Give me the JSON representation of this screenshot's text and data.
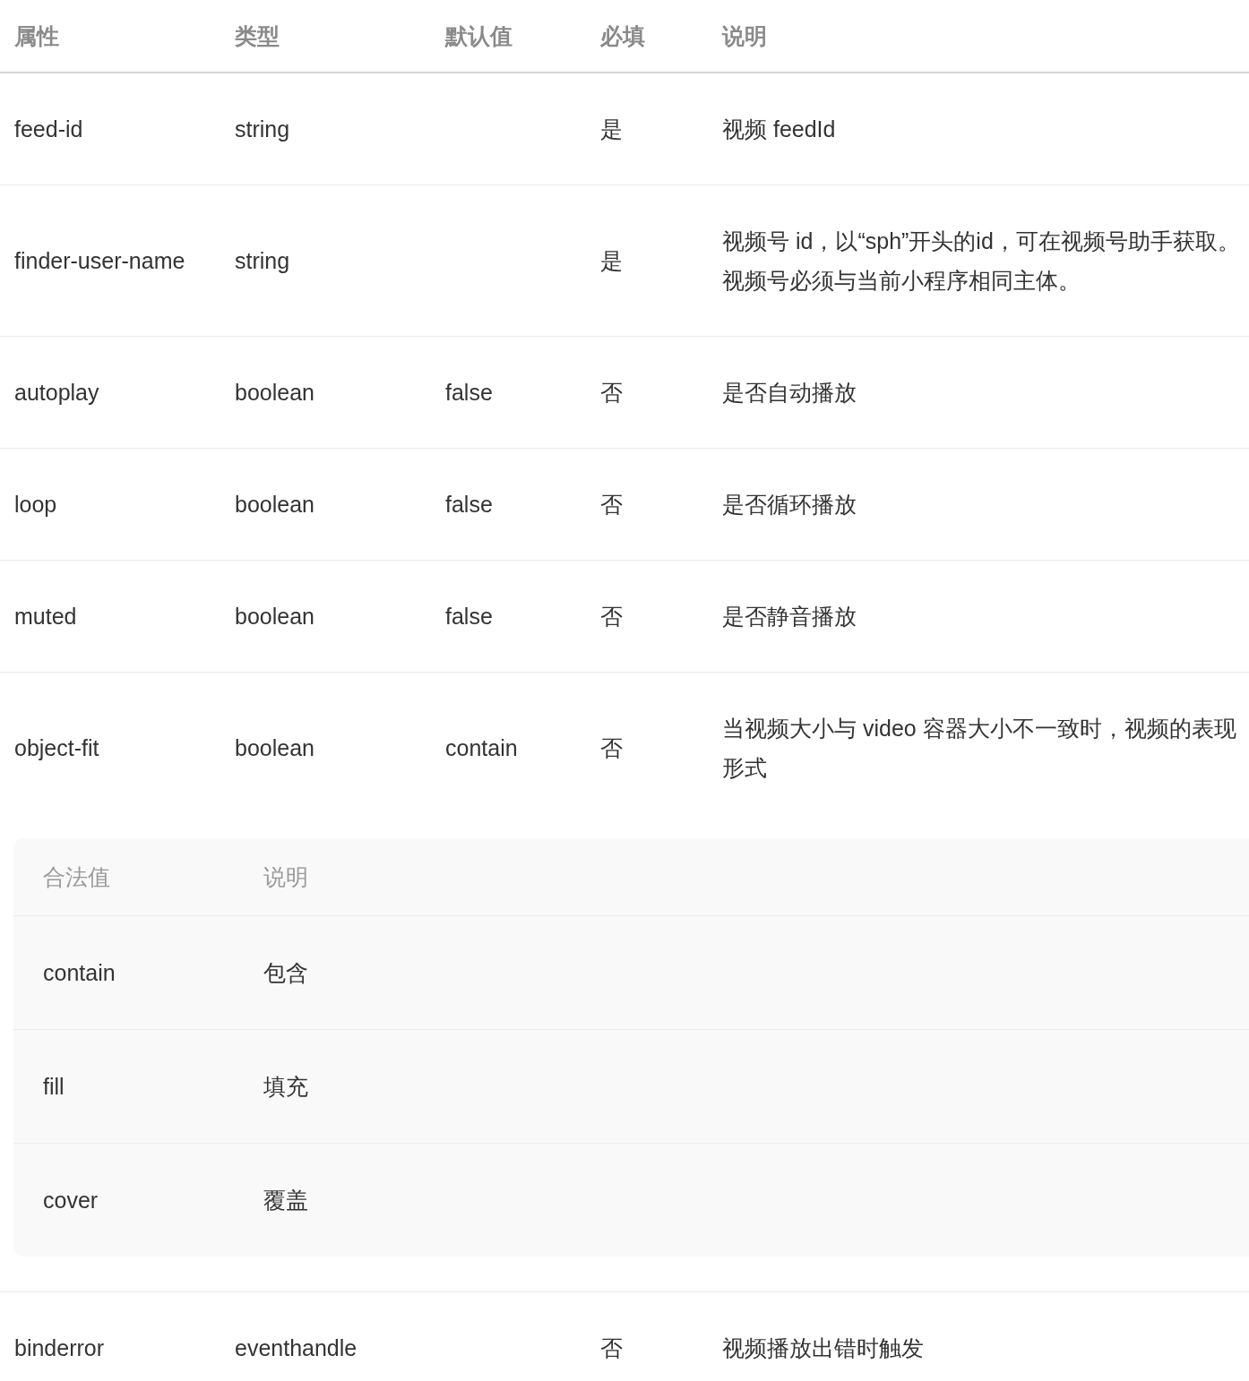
{
  "table": {
    "columns": [
      "属性",
      "类型",
      "默认值",
      "必填",
      "说明"
    ],
    "rows": [
      {
        "cells": [
          "feed-id",
          "string",
          "",
          "是",
          "视频 feedId"
        ]
      },
      {
        "cells": [
          "finder-user-name",
          "string",
          "",
          "是",
          "视频号 id，以“sph”开头的id，可在视频号助手获取。视频号必须与当前小程序相同主体。"
        ]
      },
      {
        "cells": [
          "autoplay",
          "boolean",
          "false",
          "否",
          "是否自动播放"
        ]
      },
      {
        "cells": [
          "loop",
          "boolean",
          "false",
          "否",
          "是否循环播放"
        ]
      },
      {
        "cells": [
          "muted",
          "boolean",
          "false",
          "否",
          "是否静音播放"
        ]
      },
      {
        "cells": [
          "object-fit",
          "boolean",
          "contain",
          "否",
          "当视频大小与 video 容器大小不一致时，视频的表现形式"
        ],
        "legal_values": {
          "columns": [
            "合法值",
            "说明"
          ],
          "rows": [
            {
              "cells": [
                "contain",
                "包含"
              ]
            },
            {
              "cells": [
                "fill",
                "填充"
              ]
            },
            {
              "cells": [
                "cover",
                "覆盖"
              ]
            }
          ]
        }
      },
      {
        "cells": [
          "binderror",
          "eventhandle",
          "",
          "否",
          "视频播放出错时触发"
        ]
      }
    ]
  }
}
